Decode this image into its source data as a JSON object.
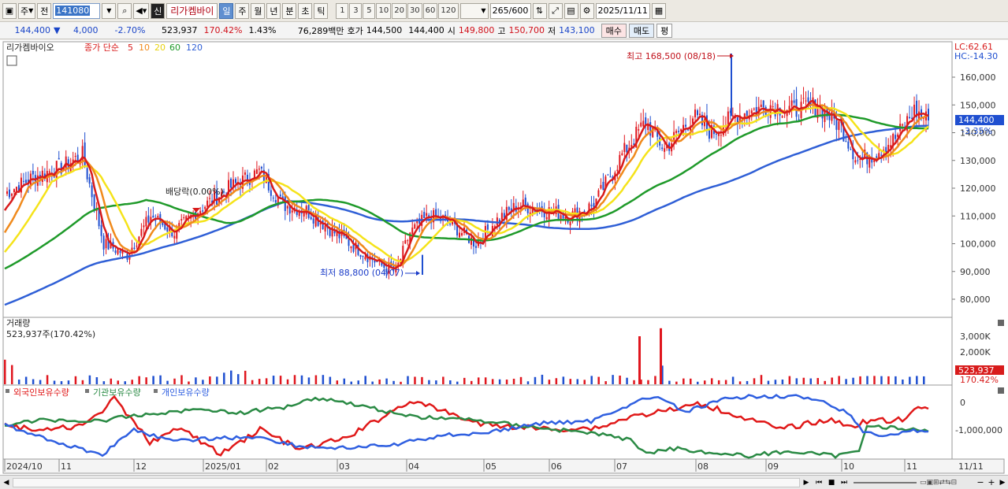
{
  "toolbar": {
    "type_label": "주",
    "prev_label": "전",
    "code": "141080",
    "badge": "신",
    "name": "리가켐바이",
    "periods": [
      "일",
      "주",
      "월",
      "년",
      "분",
      "초",
      "틱"
    ],
    "active_period": "일",
    "intervals": [
      "1",
      "3",
      "5",
      "10",
      "20",
      "30",
      "60",
      "120"
    ],
    "count": "265",
    "count_max": "/600",
    "date": "2025/11/11"
  },
  "quote": {
    "price": "144,400",
    "change": "4,000",
    "change_pct": "-2.70%",
    "volume": "523,937",
    "volume_ratio": "170.42%",
    "turnover_pct": "1.43%",
    "amount": "76,289백만",
    "ask_label": "호가",
    "ask": "144,500",
    "bid": "144,400",
    "open_label": "시",
    "open": "149,800",
    "high_label": "고",
    "high": "150,700",
    "low_label": "저",
    "low": "143,100",
    "buy_label": "매수",
    "sell_label": "매도",
    "eval_label": "평"
  },
  "price_panel": {
    "legend_name": "리가켐바이오",
    "legend_ma_title": "종가 단순",
    "ma_periods": [
      "5",
      "10",
      "20",
      "60",
      "120"
    ],
    "lc_label": "LC:62.61",
    "hc_label": "HC:-14.30",
    "y_ticks": [
      "160,000",
      "150,000",
      "140,000",
      "130,000",
      "120,000",
      "110,000",
      "100,000",
      "90,000",
      "80,000"
    ],
    "current_price": "144,400",
    "current_pct": "-3.35%",
    "high_annot": "최고 168,500 (08/18)",
    "low_annot": "최저 88,800 (04/07)",
    "dividend_annot": "배당락(0.00%)"
  },
  "volume_panel": {
    "title": "거래량",
    "value_label": "523,937주(170.42%)",
    "y_ticks": [
      "3,000K",
      "2,000K"
    ],
    "current": "523,937",
    "current_pct": "170.42%"
  },
  "holding_panel": {
    "legend": [
      "외국인보유수량",
      "기관보유수량",
      "개인보유수량"
    ],
    "y_ticks": [
      "0",
      "-1,000,000"
    ]
  },
  "x_axis": [
    "2024/10",
    "11",
    "12",
    "2025/01",
    "02",
    "03",
    "04",
    "05",
    "06",
    "07",
    "08",
    "09",
    "10",
    "11"
  ],
  "x_axis_right": "11/11",
  "colors": {
    "ma5": "#d81b1b",
    "ma10": "#f08a1c",
    "ma20": "#f5e31a",
    "ma60": "#1f9a2a",
    "ma120": "#2f5fd6",
    "up": "#e0161e",
    "down": "#1f4fd0",
    "foreign": "#e01818",
    "institution": "#2a8a44",
    "individual": "#2f5fe0"
  }
}
